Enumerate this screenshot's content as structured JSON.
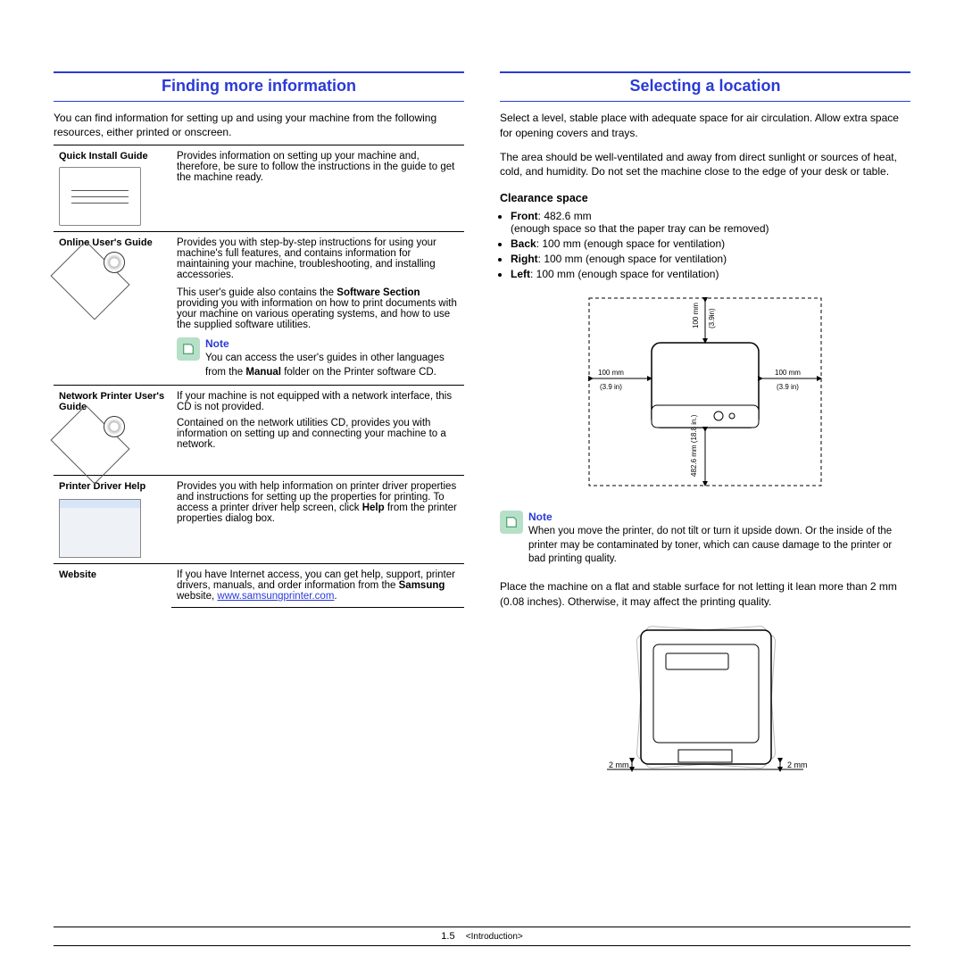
{
  "left": {
    "heading": "Finding more information",
    "intro": "You can find information for setting up and using your machine from the following resources, either printed or onscreen.",
    "rows": {
      "quick": {
        "label": "Quick Install Guide",
        "desc": "Provides information on setting up your machine and, therefore, be sure to follow the instructions in the guide to get the machine ready."
      },
      "online": {
        "label": "Online User's Guide",
        "desc1": "Provides you with step-by-step instructions for using your machine's full features, and contains information for maintaining your machine, troubleshooting, and installing accessories.",
        "desc2a": "This user's guide also contains the ",
        "desc2b": "Software Section",
        "desc2c": " providing you with information on how to print documents with your machine on various operating systems, and how to use the supplied software utilities.",
        "noteTitle": "Note",
        "note1": "You can access the user's guides in other languages from the ",
        "noteBold": "Manual",
        "note2": " folder on the Printer software CD."
      },
      "network": {
        "label": "Network Printer User's Guide",
        "desc1": "If your  machine is not equipped with a network interface,  this CD is not provided.",
        "desc2": "Contained on the network utilities CD, provides you with information on setting up and connecting your machine to a network."
      },
      "driver": {
        "label": "Printer Driver Help",
        "desc1": "Provides you with help information on printer driver properties and instructions for setting up the properties for printing. To access a printer driver help screen, click ",
        "descBold": "Help",
        "desc2": " from the printer properties dialog box."
      },
      "website": {
        "label": "Website",
        "desc1": "If you have Internet access, you can get help, support, printer drivers, manuals, and order information from the ",
        "descBold": "Samsung",
        "desc2": " website, ",
        "url": "www.samsungprinter.com",
        "desc3": "."
      }
    }
  },
  "right": {
    "heading": "Selecting a location",
    "p1": "Select a level, stable place with adequate space for air circulation. Allow extra space for opening covers and trays.",
    "p2": "The area should be well-ventilated and away from direct sunlight or sources of heat, cold, and humidity. Do not set the machine close to the edge of your desk or table.",
    "sub": "Clearance space",
    "front": {
      "label": "Front",
      "val": ": 482.6 mm",
      "note": "(enough space so that the paper tray can be removed)"
    },
    "back": {
      "label": "Back",
      "val": ": 100 mm (enough space for ventilation)"
    },
    "rightSide": {
      "label": "Right",
      "val": ": 100 mm (enough space for ventilation)"
    },
    "leftSide": {
      "label": "Left",
      "val": ": 100 mm (enough space for ventilation)"
    },
    "dia": {
      "topmm": "100 mm",
      "topin": "(3.9in)",
      "leftmm": "100 mm",
      "leftin": "(3.9 in)",
      "rightmm": "100 mm",
      "rightin": "(3.9 in)",
      "front": "482.6 mm (18.8 in.)"
    },
    "noteTitle": "Note",
    "noteBody": "When you move the printer, do not tilt or turn it upside down. Or the inside of the printer may be contaminated by toner, which can cause damage to the printer or bad printing quality.",
    "p3": "Place the machine on a flat and stable surface for not letting it lean more than 2 mm (0.08 inches). Otherwise, it may affect the printing quality.",
    "tilt": {
      "left": "2 mm",
      "right": "2 mm"
    }
  },
  "footer": {
    "page": "1.5",
    "chapter": "<Introduction>"
  }
}
